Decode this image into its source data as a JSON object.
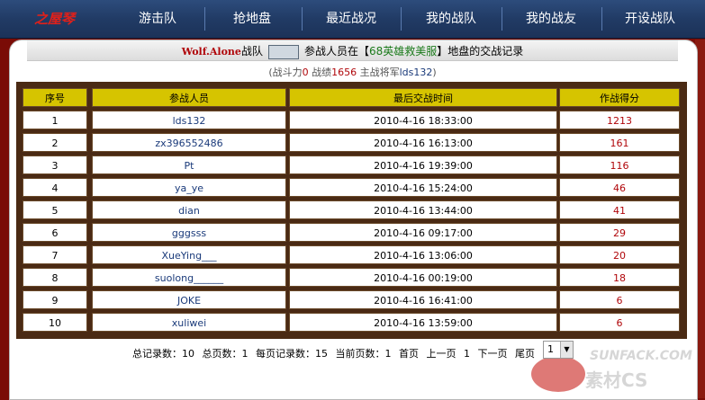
{
  "nav": {
    "logo": "之屋琴",
    "items": [
      "游击队",
      "抢地盘",
      "最近战况",
      "我的战队",
      "我的战友",
      "开设战队"
    ]
  },
  "header": {
    "team_name": "Wolf.Alone",
    "team_suffix": "战队",
    "text_before_server": "参战人员在【",
    "server": "68英雄救美服",
    "text_after_server": "】地盘的交战记录"
  },
  "subline": {
    "power_label": "(战斗力",
    "power": "0",
    "record_label": " 战绩",
    "record": "1656",
    "general_label": " 主战将军",
    "general": "lds132",
    "close": ")"
  },
  "table": {
    "headers": [
      "序号",
      "参战人员",
      "最后交战时间",
      "作战得分"
    ],
    "rows": [
      {
        "no": "1",
        "name": "lds132",
        "time": "2010-4-16  18:33:00",
        "score": "1213"
      },
      {
        "no": "2",
        "name": "zx396552486",
        "time": "2010-4-16  16:13:00",
        "score": "161"
      },
      {
        "no": "3",
        "name": "Pt",
        "time": "2010-4-16  19:39:00",
        "score": "116"
      },
      {
        "no": "4",
        "name": "ya_ye",
        "time": "2010-4-16  15:24:00",
        "score": "46"
      },
      {
        "no": "5",
        "name": "dian",
        "time": "2010-4-16  13:44:00",
        "score": "41"
      },
      {
        "no": "6",
        "name": "gggsss",
        "time": "2010-4-16  09:17:00",
        "score": "29"
      },
      {
        "no": "7",
        "name": "XueYing___",
        "time": "2010-4-16  13:06:00",
        "score": "20"
      },
      {
        "no": "8",
        "name": "suolong______",
        "time": "2010-4-16  00:19:00",
        "score": "18"
      },
      {
        "no": "9",
        "name": "JOKE",
        "time": "2010-4-16  16:41:00",
        "score": "6"
      },
      {
        "no": "10",
        "name": "xuliwei",
        "time": "2010-4-16  13:59:00",
        "score": "6"
      }
    ]
  },
  "pager": {
    "total_records": "总记录数：10",
    "total_pages": "总页数：1",
    "per_page": "每页记录数：15",
    "current_page": "当前页数：1",
    "first": "首页",
    "prev": "上一页",
    "page_num": "1",
    "next": "下一页",
    "last": "尾页",
    "select_value": "1"
  },
  "watermark": {
    "line1": "SUNFACK.COM",
    "line2": "素材CS"
  }
}
